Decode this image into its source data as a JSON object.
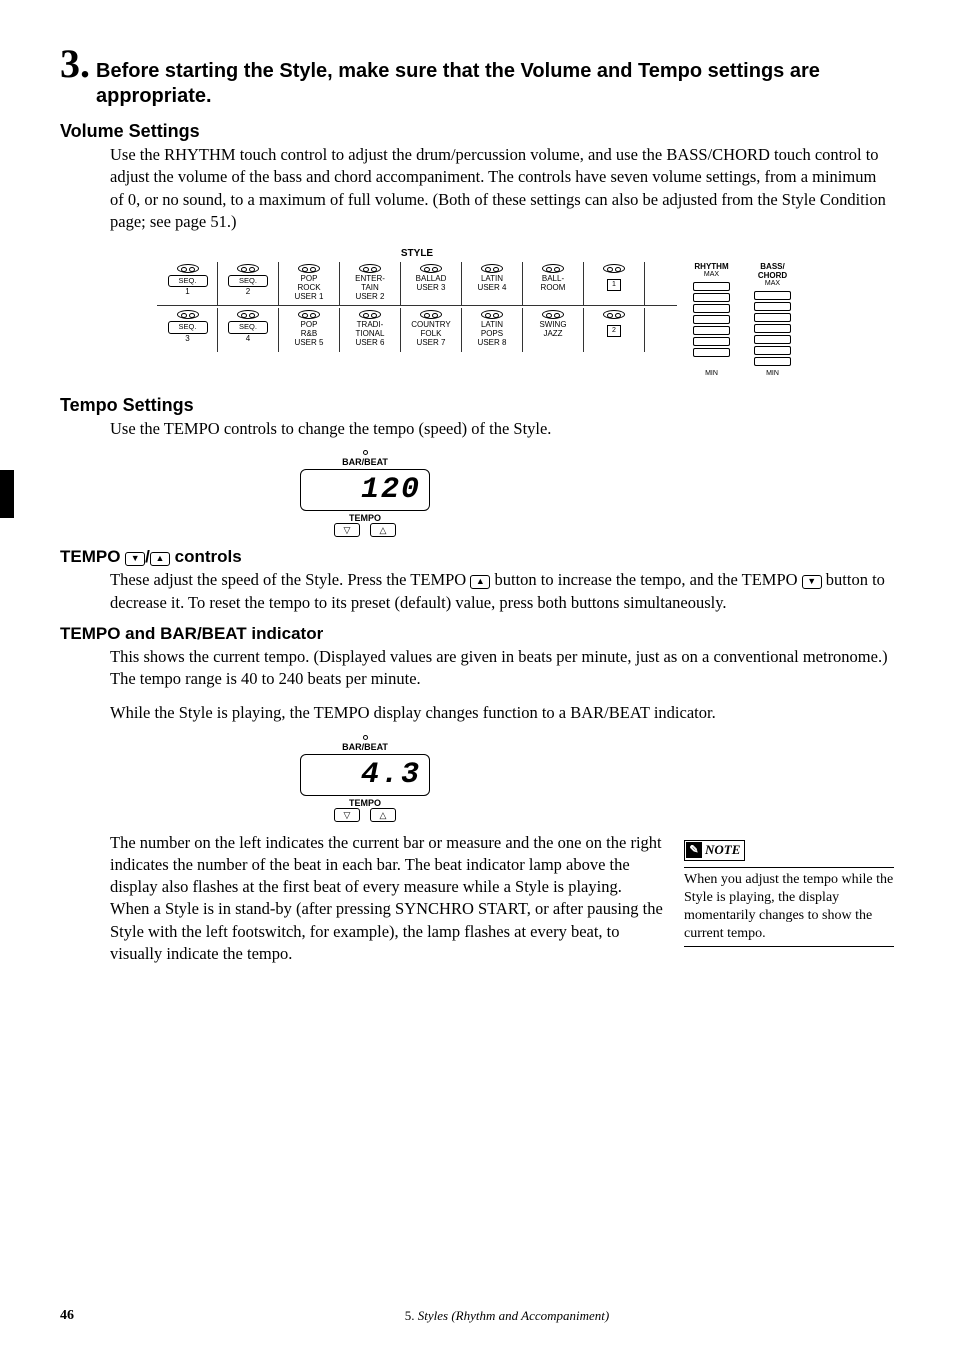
{
  "step": {
    "number": "3.",
    "title": "Before starting the Style, make sure that the Volume and Tempo settings are appropriate."
  },
  "volume": {
    "heading": "Volume Settings",
    "body": "Use the RHYTHM touch control to adjust the drum/percussion volume, and use the BASS/CHORD touch control to adjust the volume of the bass and chord accompaniment.  The controls have seven volume settings, from a minimum of 0, or no sound, to a maximum of full volume.  (Both of these settings can also be adjusted from the Style Condition page; see page 51.)"
  },
  "style_panel": {
    "title": "STYLE",
    "row1": [
      {
        "t": "btn",
        "label": "SEQ.",
        "sub": "1"
      },
      {
        "t": "btn",
        "label": "SEQ.",
        "sub": "2"
      },
      {
        "t": "txt",
        "l1": "POP",
        "l2": "ROCK",
        "l3": "USER 1"
      },
      {
        "t": "txt",
        "l1": "ENTER-",
        "l2": "TAIN",
        "l3": "USER 2"
      },
      {
        "t": "txt",
        "l1": "BALLAD",
        "l2": "",
        "l3": "USER 3"
      },
      {
        "t": "txt",
        "l1": "LATIN",
        "l2": "",
        "l3": "USER 4"
      },
      {
        "t": "txt",
        "l1": "BALL-",
        "l2": "ROOM",
        "l3": ""
      },
      {
        "t": "sq",
        "label": "1"
      }
    ],
    "row2": [
      {
        "t": "btn",
        "label": "SEQ.",
        "sub": "3"
      },
      {
        "t": "btn",
        "label": "SEQ.",
        "sub": "4"
      },
      {
        "t": "txt",
        "l1": "POP",
        "l2": "R&B",
        "l3": "USER 5"
      },
      {
        "t": "txt",
        "l1": "TRADI-",
        "l2": "TIONAL",
        "l3": "USER 6"
      },
      {
        "t": "txt",
        "l1": "COUNTRY",
        "l2": "FOLK",
        "l3": "USER 7"
      },
      {
        "t": "txt",
        "l1": "LATIN",
        "l2": "POPS",
        "l3": "USER 8"
      },
      {
        "t": "txt",
        "l1": "SWING",
        "l2": "JAZZ",
        "l3": ""
      },
      {
        "t": "sq",
        "label": "2"
      }
    ],
    "vol1": {
      "title": "RHYTHM",
      "max": "MAX",
      "min": "MIN"
    },
    "vol2": {
      "title": "BASS/\nCHORD",
      "max": "MAX",
      "min": "MIN"
    }
  },
  "tempo": {
    "heading": "Tempo Settings",
    "body": "Use the TEMPO controls to change the tempo (speed) of the Style."
  },
  "tempo_display1": {
    "bb": "BAR/BEAT",
    "val": "120",
    "label": "TEMPO",
    "down": "▽",
    "up": "△"
  },
  "tempo_controls": {
    "heading_prefix": "TEMPO ",
    "heading_suffix": " controls",
    "body1a": "These adjust the speed of the Style.  Press the TEMPO ",
    "body1b": " button to increase the tempo, and the TEMPO ",
    "body1c": " button to decrease it.  To reset the tempo to its preset (default) value, press both buttons simultaneously."
  },
  "tempo_indicator": {
    "heading": "TEMPO and BAR/BEAT indicator",
    "body1": "This shows the current tempo.  (Displayed values are given in beats per minute, just as on a conventional metronome.)  The tempo range is 40 to 240 beats per minute.",
    "body2": "While the Style is playing, the TEMPO display changes function to a BAR/BEAT indicator."
  },
  "tempo_display2": {
    "bb": "BAR/BEAT",
    "val": "4.3",
    "label": "TEMPO",
    "down": "▽",
    "up": "△"
  },
  "bottom": {
    "body": "The number on the left indicates the current bar or measure and the one on the right indicates the number of the beat in each bar.  The beat indicator lamp above the display also flashes at the first beat of every measure while a Style is playing.  When a Style is in stand-by (after pressing SYNCHRO START, or after pausing the Style with the left footswitch, for example), the lamp flashes at every beat, to visually indicate the tempo."
  },
  "note": {
    "label": "NOTE",
    "body": "When you adjust the tempo while the Style is playing, the display momentarily changes to show the current tempo."
  },
  "footer": {
    "page": "46",
    "chapter_prefix": "5. ",
    "chapter": "Styles (Rhythm and Accompaniment)"
  },
  "icons": {
    "down": "▼",
    "up": "▲"
  }
}
